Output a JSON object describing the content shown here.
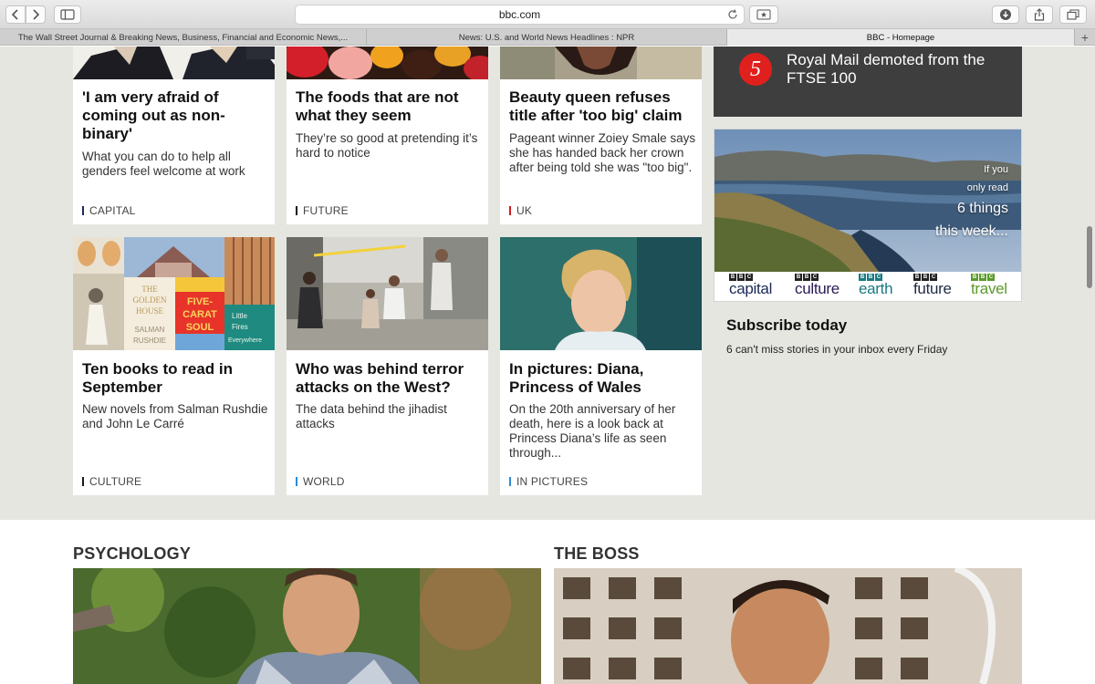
{
  "browser": {
    "url": "bbc.com",
    "tabs": [
      {
        "label": "The Wall Street Journal & Breaking News, Business, Financial and Economic News,...",
        "active": false
      },
      {
        "label": "News: U.S. and World News Headlines : NPR",
        "active": false
      },
      {
        "label": "BBC - Homepage",
        "active": true
      }
    ],
    "new_tab": "+"
  },
  "top_row": [
    {
      "title": "'I am very afraid of coming out as non-binary'",
      "desc": "What you can do to help all genders feel welcome at work",
      "tag": "CAPITAL",
      "tag_color": "#1b2a55"
    },
    {
      "title": "The foods that are not what they seem",
      "desc": "They’re so good at pretending it’s hard to notice",
      "tag": "FUTURE",
      "tag_color": "#1a1a1a"
    },
    {
      "title": "Beauty queen refuses title after 'too big' claim",
      "desc": "Pageant winner Zoiey Smale says she has handed back her crown after being told she was \"too big\".",
      "tag": "UK",
      "tag_color": "#d21a1a"
    }
  ],
  "bottom_row": [
    {
      "title": "Ten books to read in September",
      "desc": "New novels from Salman Rushdie and John Le Carré",
      "tag": "CULTURE",
      "tag_color": "#1a1a1a"
    },
    {
      "title": "Who was behind terror attacks on the West?",
      "desc": "The data behind the jihadist attacks",
      "tag": "WORLD",
      "tag_color": "#2c8bd6"
    },
    {
      "title": "In pictures: Diana, Princess of Wales",
      "desc": "On the 20th anniversary of her death, here is a look back at Princess Diana’s life as seen through...",
      "tag": "IN PICTURES",
      "tag_color": "#2c8bd6"
    }
  ],
  "book_covers": {
    "golden_house": [
      "THE",
      "GOLDEN",
      "HOUSE",
      "SALMAN",
      "RUSHDIE"
    ],
    "five_carat": [
      "FIVE-",
      "CARAT",
      "SOUL"
    ],
    "little_fires": [
      "Little",
      "Fires",
      "Everywhere"
    ]
  },
  "most_read": {
    "number": "5",
    "text": "Royal Mail demoted from the FTSE 100"
  },
  "promo": {
    "line1": "If you",
    "line2": "only read",
    "line3": "6 things",
    "line4": "this week...",
    "brands": [
      {
        "name": "capital",
        "color": "#1b2a55"
      },
      {
        "name": "culture",
        "color": "#2a1a55"
      },
      {
        "name": "earth",
        "color": "#1a7a82"
      },
      {
        "name": "future",
        "color": "#1f2a44"
      },
      {
        "name": "travel",
        "color": "#5a9a2a"
      }
    ],
    "bbc_letters": [
      "B",
      "B",
      "C"
    ]
  },
  "subscribe": {
    "title": "Subscribe today",
    "subtitle": "6 can't miss stories in your inbox every Friday"
  },
  "sections": [
    {
      "title": "PSYCHOLOGY"
    },
    {
      "title": "THE BOSS"
    }
  ]
}
